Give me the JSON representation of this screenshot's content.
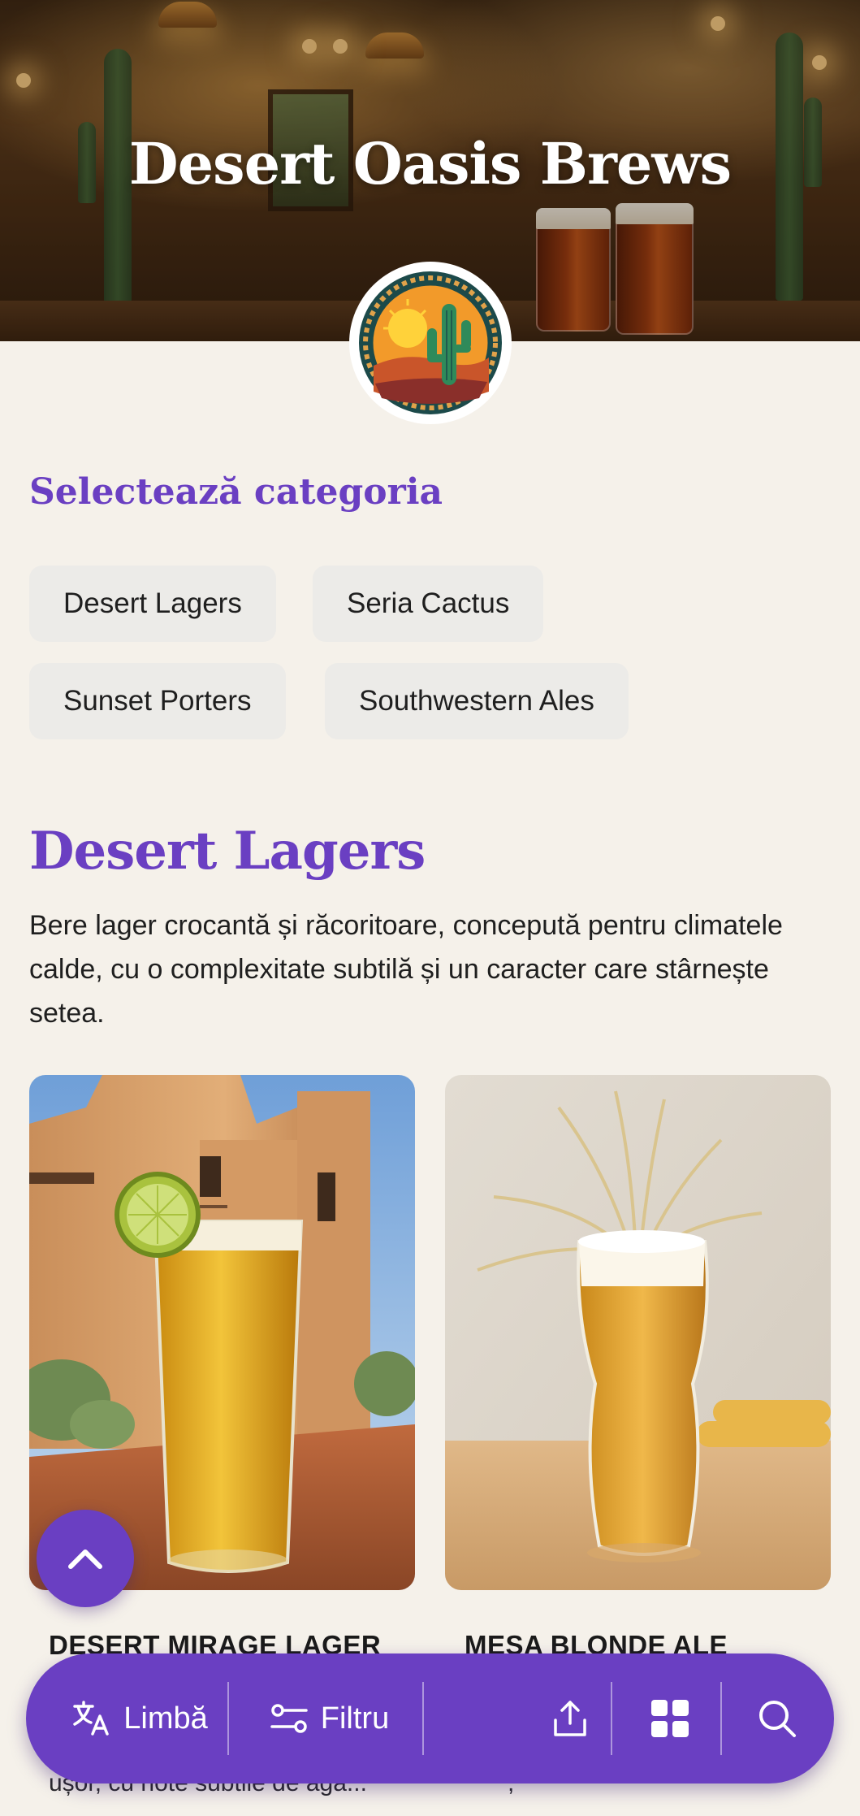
{
  "header": {
    "title": "Desert Oasis Brews"
  },
  "category_selector": {
    "heading": "Selectează categoria",
    "chips": [
      {
        "label": "Desert Lagers"
      },
      {
        "label": "Seria Cactus"
      },
      {
        "label": "Sunset Porters"
      },
      {
        "label": "Southwestern Ales"
      }
    ]
  },
  "category": {
    "title": "Desert Lagers",
    "description": "Bere lager crocantă și răcoritoare, concepută pentru climatele calde, cu o complexitate subtilă și un caracter care stârnește setea."
  },
  "products": [
    {
      "name": "DESERT MIRAGE LAGER",
      "description_preview": "ușor, cu note subtile de aga..."
    },
    {
      "name": "MESA BLONDE ALE",
      "description_preview": ","
    }
  ],
  "bottom_bar": {
    "language_label": "Limbă",
    "filter_label": "Filtru"
  },
  "icons": {
    "scroll_top": "chevron-up-icon",
    "language": "translate-icon",
    "filter": "sliders-icon",
    "share": "share-icon",
    "grid": "grid-icon",
    "search": "search-icon"
  },
  "colors": {
    "accent": "#6a3fc2",
    "background": "#f5f1ea",
    "chip": "#ecebe8"
  }
}
